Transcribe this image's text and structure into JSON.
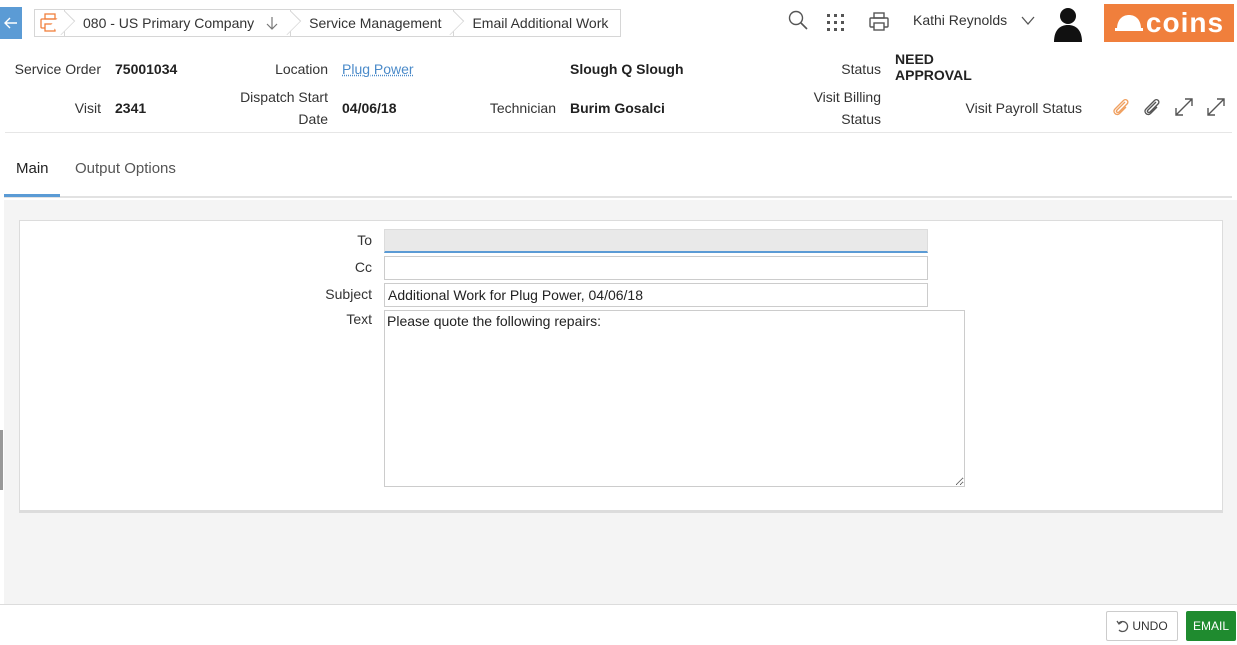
{
  "breadcrumb": {
    "company": "080 - US Primary Company",
    "module": "Service Management",
    "page": "Email Additional Work"
  },
  "user": {
    "name": "Kathi Reynolds"
  },
  "brand": {
    "logo_text": "coins",
    "accent": "#f07f3c"
  },
  "header": {
    "service_order_label": "Service Order",
    "service_order_value": "75001034",
    "location_label": "Location",
    "location_value": "Plug Power",
    "site_value": "Slough Q Slough",
    "status_label": "Status",
    "status_value_line1": "NEED",
    "status_value_line2": "APPROVAL",
    "visit_label": "Visit",
    "visit_value": "2341",
    "dispatch_label_line1": "Dispatch Start",
    "dispatch_label_line2": "Date",
    "dispatch_value": "04/06/18",
    "technician_label": "Technician",
    "technician_value": "Burim Gosalci",
    "billing_label_line1": "Visit Billing",
    "billing_label_line2": "Status",
    "payroll_label": "Visit Payroll Status"
  },
  "tabs": [
    {
      "label": "Main",
      "active": true
    },
    {
      "label": "Output Options",
      "active": false
    }
  ],
  "form": {
    "to_label": "To",
    "to_value": "",
    "cc_label": "Cc",
    "cc_value": "",
    "subject_label": "Subject",
    "subject_value": "Additional Work for Plug Power, 04/06/18",
    "text_label": "Text",
    "text_value": "Please quote the following repairs:"
  },
  "footer": {
    "undo_label": "UNDO",
    "email_label": "EMAIL"
  },
  "colors": {
    "primary": "#5b9bd5",
    "email_button": "#1f8b2f",
    "attachment_active": "#f0a060"
  }
}
